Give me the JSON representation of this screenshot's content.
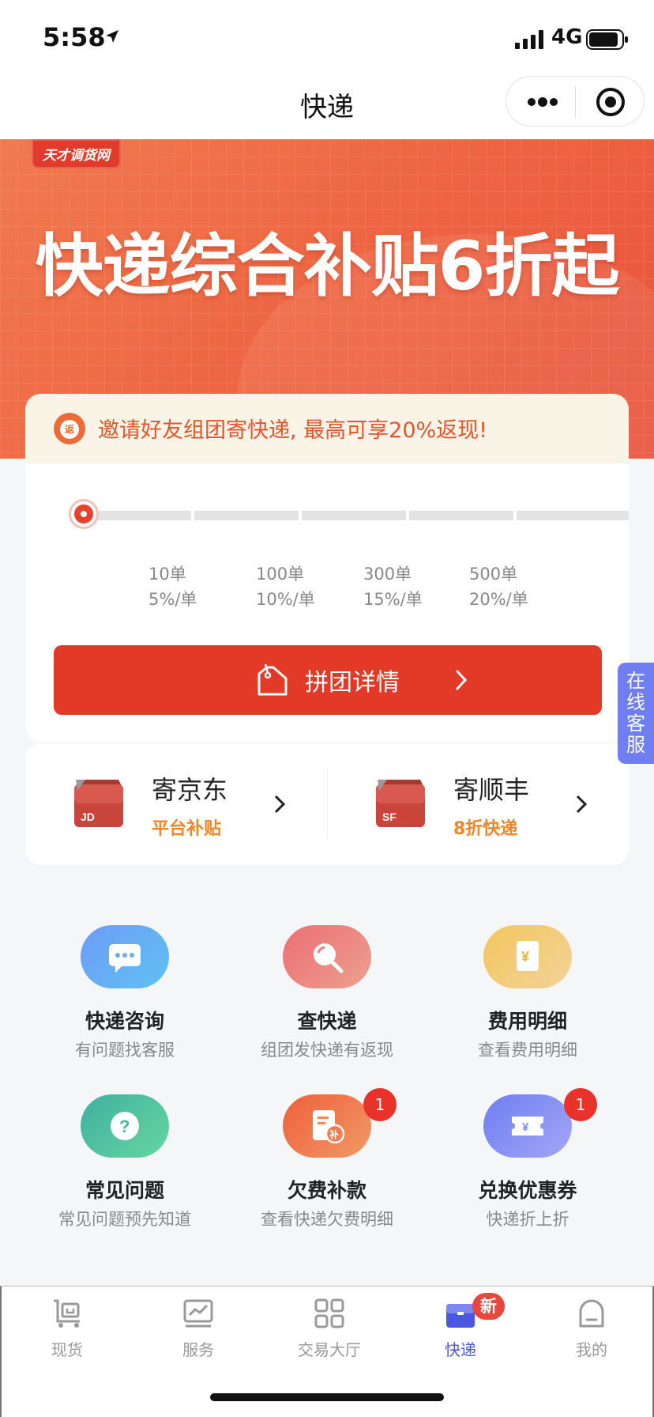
{
  "status_bar": {
    "time": "5:58",
    "network": "4G"
  },
  "nav": {
    "title": "快递"
  },
  "banner": {
    "logo": "天才调货网",
    "headline": "快递综合补贴6折起"
  },
  "group": {
    "invite_icon": "返",
    "invite_text": "邀请好友组团寄快递, 最高可享20%返现!",
    "progress": 0,
    "tiers": [
      {
        "orders": "10单",
        "rate": "5%/单"
      },
      {
        "orders": "100单",
        "rate": "10%/单"
      },
      {
        "orders": "300单",
        "rate": "15%/单"
      },
      {
        "orders": "500单",
        "rate": "20%/单"
      }
    ],
    "button_label": "拼团详情"
  },
  "couriers": [
    {
      "name": "寄京东",
      "sub": "平台补贴",
      "logo": "JD"
    },
    {
      "name": "寄顺丰",
      "sub": "8折快递",
      "logo": "SF"
    }
  ],
  "services": [
    {
      "title": "快递咨询",
      "subtitle": "有问题找客服",
      "icon": "chat-icon"
    },
    {
      "title": "查快递",
      "subtitle": "组团发快递有返现",
      "icon": "search-icon"
    },
    {
      "title": "费用明细",
      "subtitle": "查看费用明细",
      "icon": "bill-icon"
    },
    {
      "title": "常见问题",
      "subtitle": "常见问题预先知道",
      "icon": "question-icon"
    },
    {
      "title": "欠费补款",
      "subtitle": "查看快递欠费明细",
      "icon": "repay-icon",
      "badge": "1"
    },
    {
      "title": "兑换优惠券",
      "subtitle": "快递折上折",
      "icon": "coupon-icon",
      "badge": "1"
    }
  ],
  "side_float": {
    "chars": [
      "在",
      "线",
      "客",
      "服"
    ]
  },
  "tabs": [
    {
      "label": "现货",
      "icon": "cart-icon"
    },
    {
      "label": "服务",
      "icon": "chart-icon"
    },
    {
      "label": "交易大厅",
      "icon": "grid-icon"
    },
    {
      "label": "快递",
      "icon": "express-icon",
      "badge": "新",
      "active": true
    },
    {
      "label": "我的",
      "icon": "profile-icon"
    }
  ],
  "colors": {
    "accent": "#e23a26",
    "tab_active": "#4b57e0",
    "subsidy": "#f0852a"
  }
}
